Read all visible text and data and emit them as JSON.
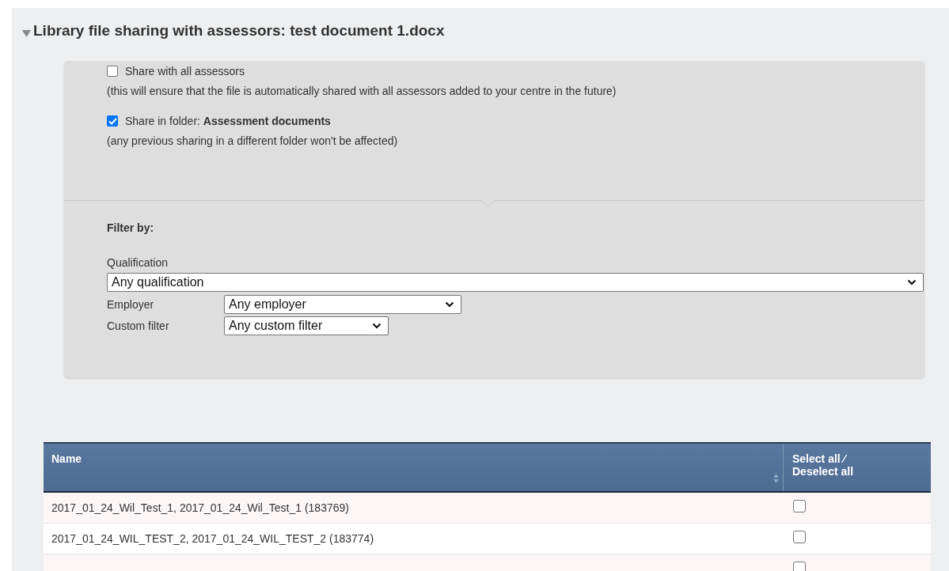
{
  "section": {
    "title": "Library file sharing with assessors: test document 1.docx",
    "expanded": true
  },
  "share_options": [
    {
      "label": "Share with all assessors",
      "checked": false,
      "note": "(this will ensure that the file is automatically shared with all assessors added to your centre in the future)"
    },
    {
      "label": "Share in folder: **Assessment documents**",
      "checked": true,
      "note": "(any previous sharing in a different folder won't be affected)"
    }
  ],
  "filter": {
    "heading": "Filter by:",
    "qualification": {
      "label": "Qualification",
      "value": "Any qualification"
    },
    "fields": [
      {
        "label": "Employer",
        "value": "Any employer"
      },
      {
        "label": "Custom filter",
        "value": "Any custom filter"
      }
    ]
  },
  "table": {
    "columns": [
      "Name",
      "Select all ⁄\nDeselect all"
    ],
    "rows": [
      {
        "name": "2017_01_24_Wil_Test_1, 2017_01_24_Wil_Test_1 (183769)",
        "checked": false
      },
      {
        "name": "2017_01_24_WIL_TEST_2, 2017_01_24_WIL_TEST_2 (183774)",
        "checked": false
      },
      {
        "name": "",
        "checked": false
      }
    ]
  }
}
